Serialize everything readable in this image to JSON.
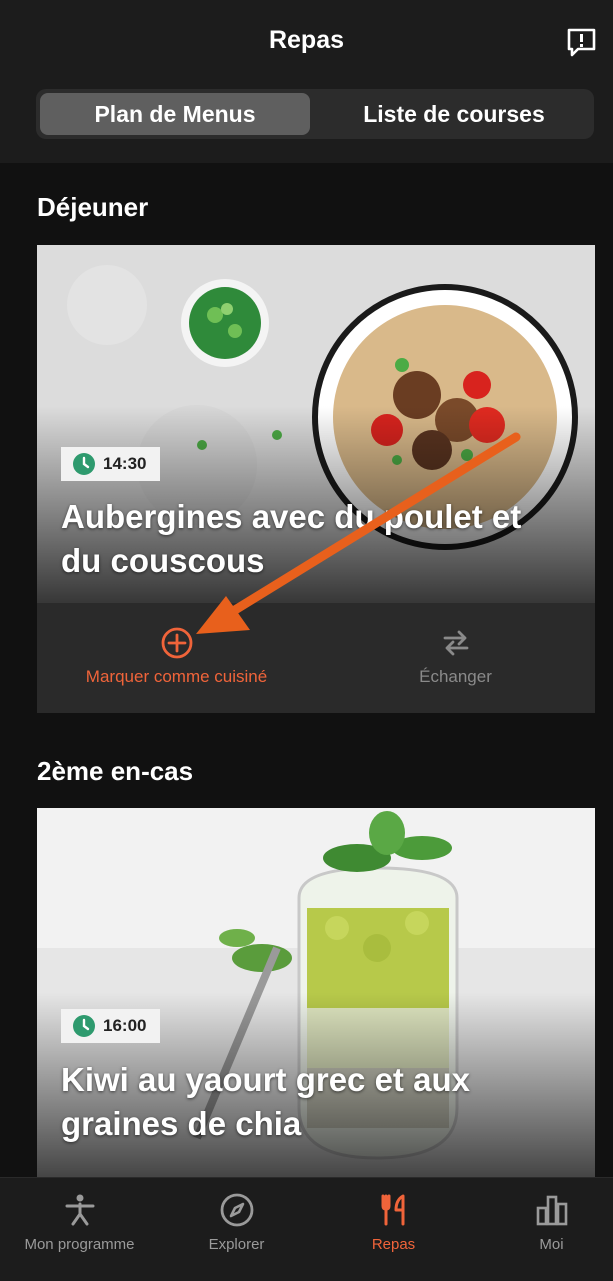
{
  "header": {
    "title": "Repas"
  },
  "tabs": [
    {
      "label": "Plan de Menus",
      "active": true
    },
    {
      "label": "Liste de courses",
      "active": false
    }
  ],
  "meals": [
    {
      "section": "Déjeuner",
      "time": "14:30",
      "title_line1": "Aubergines avec du poulet et",
      "title_line2": "du couscous",
      "actions": {
        "cook": "Marquer comme cuisiné",
        "swap": "Échanger"
      }
    },
    {
      "section": "2ème en-cas",
      "time": "16:00",
      "title_line1": "Kiwi au yaourt grec et aux",
      "title_line2": "graines de chia"
    }
  ],
  "nav": [
    {
      "label": "Mon programme",
      "icon": "person-stretch-icon",
      "active": false
    },
    {
      "label": "Explorer",
      "icon": "compass-icon",
      "active": false
    },
    {
      "label": "Repas",
      "icon": "fork-knife-icon",
      "active": true
    },
    {
      "label": "Moi",
      "icon": "bar-chart-icon",
      "active": false
    }
  ],
  "colors": {
    "accent": "#f0643a",
    "time_icon": "#2e9a6e",
    "background": "#111111"
  }
}
